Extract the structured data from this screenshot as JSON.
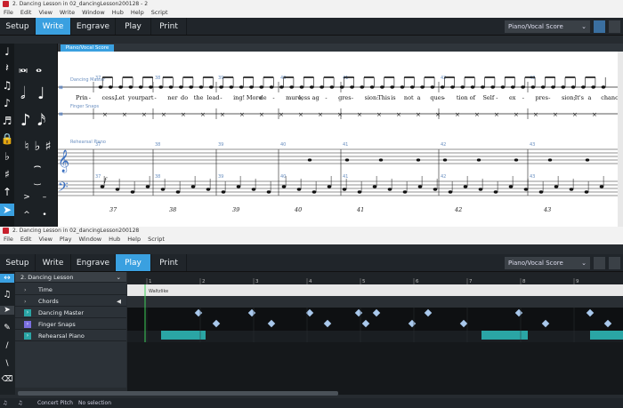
{
  "write_window": {
    "title": "2. Dancing Lesson in 02_dancingLesson200128 - 2",
    "menu": [
      "File",
      "Edit",
      "View",
      "Write",
      "Window",
      "Hub",
      "Help",
      "Script"
    ],
    "modes": [
      "Setup",
      "Write",
      "Engrave",
      "Play",
      "Print"
    ],
    "active_mode": "Write",
    "layout": "Piano/Vocal Score",
    "layout_tab": "Piano/Vocal Score"
  },
  "score": {
    "staff_labels": [
      "Dancing Master",
      "Finger Snaps",
      "Rehearsal Piano"
    ],
    "bar_numbers": [
      "37",
      "38",
      "39",
      "40",
      "41",
      "42",
      "43"
    ],
    "piano_bar_numbers": [
      "37",
      "38",
      "39",
      "40",
      "41",
      "42",
      "43"
    ],
    "lyrics": [
      "Prin",
      "-",
      "cess,",
      "Let",
      "your",
      "part",
      "-",
      "ner",
      "do",
      "the",
      "lead",
      "-",
      "ing!",
      "More",
      "de",
      "-",
      "mure,",
      "less",
      "ag",
      "-",
      "gres",
      "-",
      "sion:",
      "This",
      "is",
      "not",
      "a",
      "ques",
      "-",
      "tion",
      "of",
      "Self",
      "-",
      "ex",
      "-",
      "pres",
      "-",
      "sion;",
      "It's",
      "a",
      "chance"
    ],
    "dynamic": "f"
  },
  "play_window": {
    "title": "2. Dancing Lesson in 02_dancingLesson200128",
    "menu": [
      "File",
      "Edit",
      "View",
      "Play",
      "Window",
      "Hub",
      "Help",
      "Script"
    ],
    "modes": [
      "Setup",
      "Write",
      "Engrave",
      "Play",
      "Print"
    ],
    "active_mode": "Play",
    "layout": "Piano/Vocal Score",
    "flow_name": "2. Dancing Lesson",
    "tracks": [
      {
        "name": "Time",
        "kind": "time"
      },
      {
        "name": "Chords",
        "kind": "chords"
      },
      {
        "name": "Dancing Master",
        "kind": "instrument",
        "color": "#2aa5a5"
      },
      {
        "name": "Finger Snaps",
        "kind": "instrument",
        "color": "#7a6fe0"
      },
      {
        "name": "Rehearsal Piano",
        "kind": "instrument",
        "color": "#2aa5a5"
      }
    ],
    "tempo_label": "Waltzlike",
    "ruler_numbers": [
      "1",
      "2",
      "3",
      "4",
      "5",
      "6",
      "7",
      "8",
      "9"
    ]
  },
  "status": {
    "concert_pitch": "Concert Pitch",
    "selection": "No selection"
  },
  "colors": {
    "accent": "#3aa0e0",
    "region": "#2aa5a5",
    "note": "#a9c8ec"
  }
}
